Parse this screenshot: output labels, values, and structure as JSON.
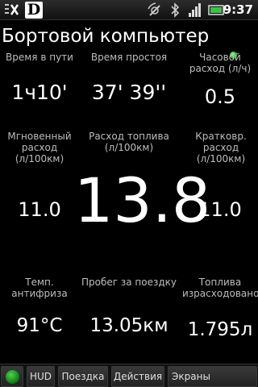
{
  "statusbar": {
    "time": "9:37",
    "icons": [
      "notification-icon",
      "app-logo-icon",
      "gps-icon",
      "bluetooth-icon",
      "signal-icon",
      "battery-icon"
    ],
    "app_logo_letter": "D"
  },
  "title": "Бортовой компьютер",
  "cells": {
    "travel_time": {
      "label": "Время в пути",
      "value": "1ч10'"
    },
    "idle_time": {
      "label": "Время простоя",
      "value": "37' 39''"
    },
    "hourly_rate": {
      "label": "Часовой расход (л/ч)",
      "value": "0.5"
    },
    "instant": {
      "label": "Мгновенный расход (л/100км)",
      "value": "11.0"
    },
    "consumption": {
      "label": "Расход топлива (л/100км)",
      "value": "13.8"
    },
    "short_term": {
      "label": "Кратковр. расход (л/100км)",
      "value": "11.0"
    },
    "coolant": {
      "label": "Темп. антифриза",
      "value": "91°C"
    },
    "trip_distance": {
      "label": "Пробег за поездку",
      "value": "13.05км"
    },
    "fuel_used": {
      "label": "Топлива израсходовано",
      "value": "1.795л"
    }
  },
  "toolbar": {
    "hud": "HUD",
    "trip": "Поездка",
    "actions": "Действия",
    "screens": "Экраны"
  },
  "colors": {
    "background": "#000000",
    "label": "#bdbdbd",
    "value": "#ffffff",
    "led": "#1fa527"
  }
}
